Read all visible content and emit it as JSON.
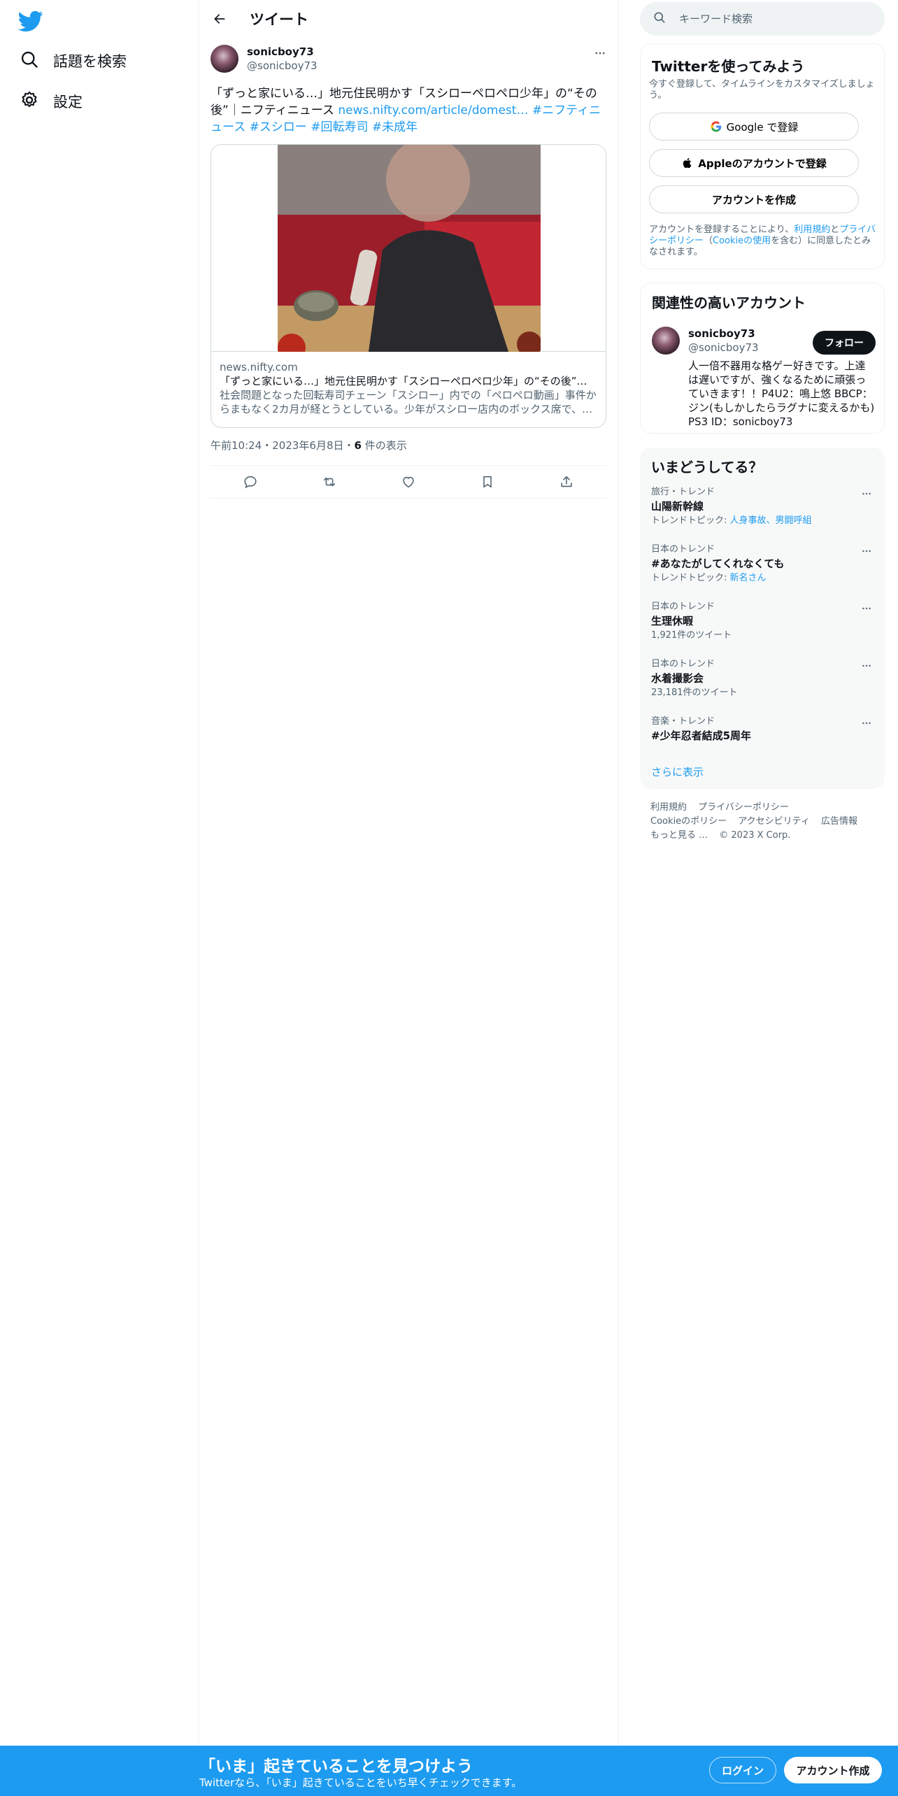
{
  "nav": {
    "items": [
      {
        "label": "話題を検索",
        "icon": "search-icon"
      },
      {
        "label": "設定",
        "icon": "gear-icon"
      }
    ]
  },
  "header": {
    "title": "ツイート"
  },
  "tweet": {
    "author_name": "sonicboy73",
    "author_handle": "@sonicboy73",
    "text": "「ずっと家にいる…」地元住民明かす「スシローペロペロ少年」の“その後”｜ニフティニュース ",
    "link": "news.nifty.com/article/domest…",
    "hashtags": [
      "#ニフティニュース",
      "#スシロー",
      "#回転寿司",
      "#未成年"
    ],
    "card": {
      "domain": "news.nifty.com",
      "title": "「ずっと家にいる…」地元住民明かす「スシローペロペロ少年」の“その後”｜ニフティニュース",
      "description": "社会問題となった回転寿司チェーン「スシロー」内での「ペロペロ動画」事件からまもなく2カ月が経とうとしている。少年がスシロー店内のボックス席で、…"
    },
    "time": "午前10:24・2023年6月8日・",
    "views_count": "6",
    "views_label": " 件の表示"
  },
  "search": {
    "placeholder": "キーワード検索"
  },
  "signup": {
    "title": "Twitterを使ってみよう",
    "subtitle": "今すぐ登録して、タイムラインをカスタマイズしましょう。",
    "google_label": "Google で登録",
    "apple_label": "Appleのアカウントで登録",
    "create_label": "アカウントを作成",
    "terms_prefix": "アカウントを登録することにより、",
    "terms_link": "利用規約",
    "terms_and": "と",
    "privacy_link": "プライバシーポリシー",
    "cookie_open": "（",
    "cookie_link": "Cookieの使用",
    "terms_suffix": "を含む）に同意したとみなされます。"
  },
  "related": {
    "title": "関連性の高いアカウント",
    "name": "sonicboy73",
    "handle": "@sonicboy73",
    "follow_label": "フォロー",
    "bio": "人一倍不器用な格ゲー好きです。上達は遅いですが、強くなるために頑張っていきます！！P4U2：鳴上悠 BBCP：ジン(もしかしたらラグナに変えるかも) PS3 ID：sonicboy73"
  },
  "trends": {
    "title": "いまどうしてる？",
    "items": [
      {
        "meta": "旅行・トレンド",
        "name": "山陽新幹線",
        "sub_prefix": "トレンドトピック: ",
        "sub_link": "人身事故、男闘呼組"
      },
      {
        "meta": "日本のトレンド",
        "name": "#あなたがしてくれなくても",
        "sub_prefix": "トレンドトピック: ",
        "sub_link": "新名さん"
      },
      {
        "meta": "日本のトレンド",
        "name": "生理休暇",
        "sub_prefix": "1,921件のツイート",
        "sub_link": ""
      },
      {
        "meta": "日本のトレンド",
        "name": "水着撮影会",
        "sub_prefix": "23,181件のツイート",
        "sub_link": ""
      },
      {
        "meta": "音楽・トレンド",
        "name": "#少年忍者結成5周年",
        "sub_prefix": "",
        "sub_link": ""
      }
    ],
    "show_more": "さらに表示"
  },
  "footer": {
    "links": [
      "利用規約",
      "プライバシーポリシー",
      "Cookieのポリシー",
      "アクセシビリティ",
      "広告情報",
      "もっと見る …"
    ],
    "copyright": "© 2023 X Corp."
  },
  "bottombar": {
    "title": "「いま」起きていることを見つけよう",
    "subtitle": "Twitterなら、「いま」起きていることをいち早くチェックできます。",
    "login_label": "ログイン",
    "signup_label": "アカウント作成"
  },
  "colors": {
    "accent": "#1d9bf0",
    "text": "#0f1419",
    "muted": "#536471"
  }
}
